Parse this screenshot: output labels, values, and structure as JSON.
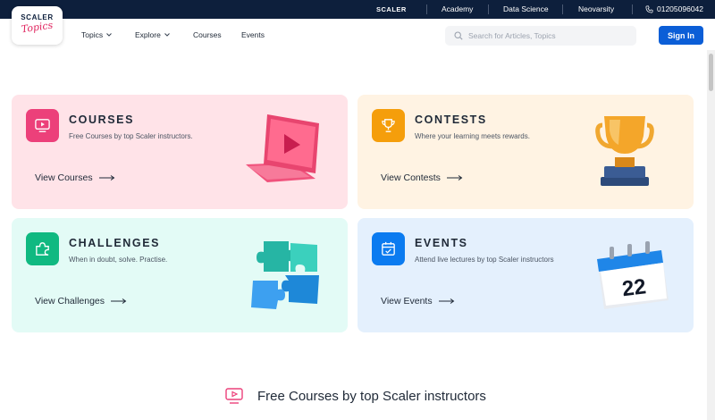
{
  "topbar": {
    "brand": "SCALER",
    "links": [
      "Academy",
      "Data Science",
      "Neovarsity"
    ],
    "phone": "01205096042"
  },
  "logo": {
    "line1": "SCALER",
    "line2": "Topics"
  },
  "nav": {
    "items": [
      "Topics",
      "Explore",
      "Courses",
      "Events"
    ],
    "search_placeholder": "Search for Articles, Topics",
    "signin_label": "Sign In"
  },
  "cards": [
    {
      "title": "COURSES",
      "subtitle": "Free Courses by top Scaler instructors.",
      "link": "View Courses",
      "accent": "#ec407a",
      "icon": "video-icon"
    },
    {
      "title": "CONTESTS",
      "subtitle": "Where your learning meets rewards.",
      "link": "View Contests",
      "accent": "#f59e0b",
      "icon": "trophy-icon"
    },
    {
      "title": "CHALLENGES",
      "subtitle": "When in doubt, solve. Practise.",
      "link": "View Challenges",
      "accent": "#10b981",
      "icon": "puzzle-icon"
    },
    {
      "title": "EVENTS",
      "subtitle": "Attend live lectures by top Scaler instructors",
      "link": "View Events",
      "accent": "#0b7bf0",
      "icon": "calendar-icon"
    }
  ],
  "calendar_art_day": "22",
  "section": {
    "heading": "Free Courses by top Scaler instructors"
  },
  "colors": {
    "topbar": "#0d1f3c",
    "signin": "#0b5ed7",
    "courses_bg": "#ffe3e8",
    "contests_bg": "#fff3e3",
    "challenges_bg": "#e3fbf6",
    "events_bg": "#e4f0fd"
  }
}
